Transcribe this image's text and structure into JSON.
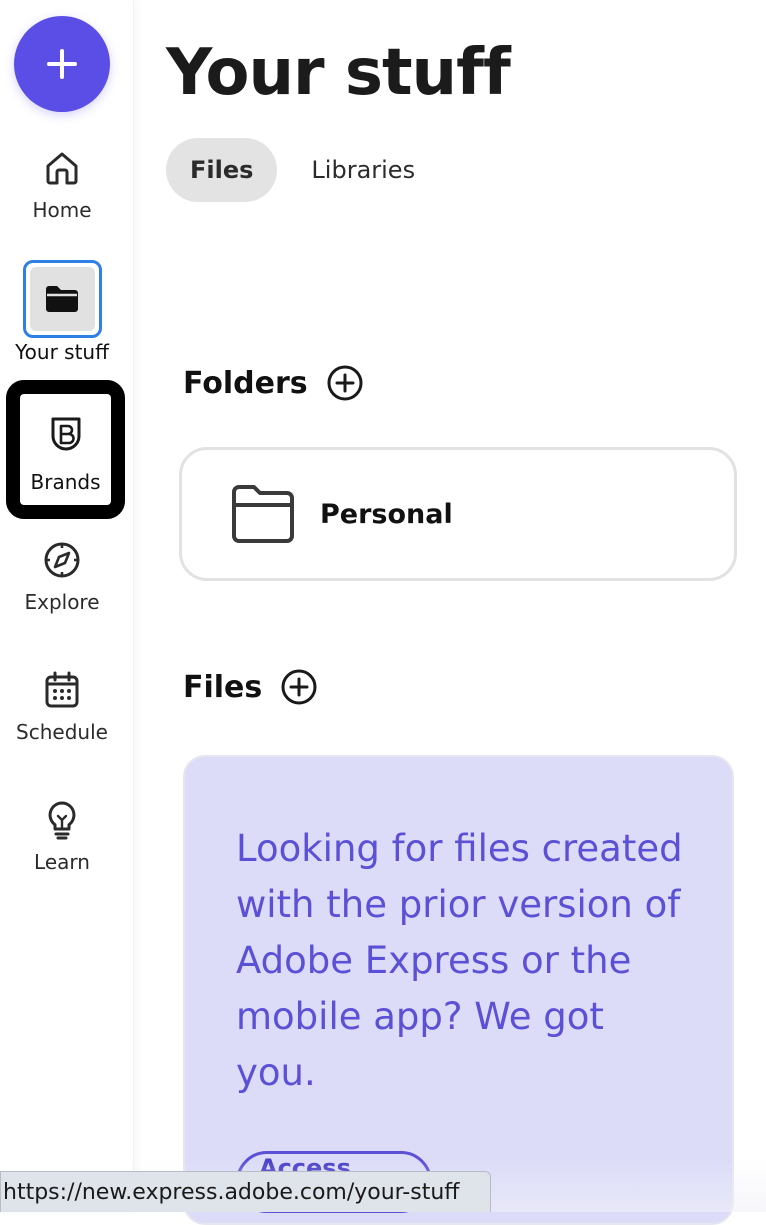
{
  "sidebar": {
    "create_icon": "plus-icon",
    "items": [
      {
        "label": "Home",
        "icon": "home-icon"
      },
      {
        "label": "Your stuff",
        "icon": "folder-icon",
        "selected": true
      },
      {
        "label": "Brands",
        "icon": "brand-shield-icon",
        "focused": true
      },
      {
        "label": "Explore",
        "icon": "compass-icon"
      },
      {
        "label": "Schedule",
        "icon": "calendar-icon"
      },
      {
        "label": "Learn",
        "icon": "lightbulb-icon"
      }
    ]
  },
  "main": {
    "title": "Your stuff",
    "tabs": [
      {
        "label": "Files",
        "active": true
      },
      {
        "label": "Libraries",
        "active": false
      }
    ],
    "folders": {
      "heading": "Folders",
      "items": [
        {
          "name": "Personal"
        }
      ]
    },
    "files": {
      "heading": "Files",
      "promo": {
        "text": "Looking for files created with the prior version of Adobe Express or the mobile app? We got you.",
        "button": "Access files"
      }
    }
  },
  "status_bar": {
    "url": "https://new.express.adobe.com/your-stuff"
  },
  "colors": {
    "accent": "#5a4ee6",
    "promo_bg": "#dcdcf8",
    "promo_text": "#5b50d6",
    "focus_ring": "#2f80e6"
  }
}
